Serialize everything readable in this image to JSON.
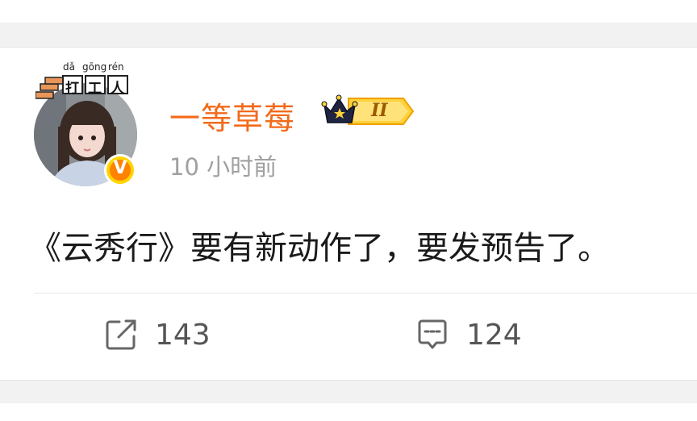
{
  "post": {
    "avatar_pendant": {
      "pinyin": [
        "dǎ",
        "gōng",
        "rén"
      ],
      "chars": [
        "打",
        "工",
        "人"
      ]
    },
    "username": "一等草莓",
    "vip_level": "II",
    "verified_badge": "V",
    "time": "10 小时前",
    "content": "《云秀行》要有新动作了，要发预告了。",
    "actions": {
      "repost_count": "143",
      "comment_count": "124"
    }
  },
  "colors": {
    "username": "#f26a1b",
    "time": "#a0a0a0",
    "badge_orange": "#ff8200",
    "badge_yellow": "#ffd400"
  }
}
